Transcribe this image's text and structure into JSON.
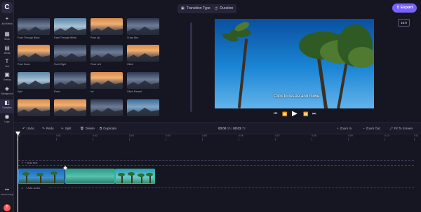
{
  "app": {
    "logo_letter": "C"
  },
  "sidebar": {
    "items": [
      {
        "label": "Add Media",
        "icon": "plus-icon",
        "glyph": "+"
      },
      {
        "label": "Stock",
        "icon": "stock-icon",
        "glyph": "▦"
      },
      {
        "label": "Media",
        "icon": "media-icon",
        "glyph": "▤"
      },
      {
        "label": "Text",
        "icon": "text-icon",
        "glyph": "T"
      },
      {
        "label": "Overlay",
        "icon": "overlay-icon",
        "glyph": "▣"
      },
      {
        "label": "Background",
        "icon": "background-icon",
        "glyph": "◈"
      },
      {
        "label": "Transition",
        "icon": "transition-icon",
        "glyph": "◧"
      },
      {
        "label": "Logo",
        "icon": "logo-icon",
        "glyph": "◉"
      }
    ],
    "feature_flags": "Feature Flags",
    "avatar_letter": "T"
  },
  "topbar": {
    "transition_type": "Transition Type",
    "duration": "Duration",
    "export": "Export"
  },
  "library": {
    "tiles": [
      {
        "caption": "Fade Through Black",
        "style": "dark"
      },
      {
        "caption": "Fade Through White",
        "style": "teal"
      },
      {
        "caption": "Push Up",
        "style": "warm"
      },
      {
        "caption": "Cross Blur",
        "style": "dark"
      },
      {
        "caption": "Push Down",
        "style": "warm"
      },
      {
        "caption": "Push Right",
        "style": "dark"
      },
      {
        "caption": "Push Left",
        "style": "dark"
      },
      {
        "caption": "Glitch",
        "style": "warm"
      },
      {
        "caption": "Split",
        "style": "teal"
      },
      {
        "caption": "Flash",
        "style": "dark"
      },
      {
        "caption": "Ink",
        "style": "warm"
      },
      {
        "caption": "Glitch Reveal",
        "style": "dark"
      },
      {
        "caption": "",
        "style": "warm"
      },
      {
        "caption": "",
        "style": "warm"
      },
      {
        "caption": "",
        "style": "dark"
      },
      {
        "caption": "",
        "style": "blue"
      }
    ]
  },
  "preview": {
    "hint": "Click to resize and move",
    "aspect_ratio": "16:9"
  },
  "timeline": {
    "toolbar": {
      "undo": "Undo",
      "redo": "Redo",
      "split": "Split",
      "delete": "Delete",
      "duplicate": "Duplicate",
      "zoom_in": "Zoom In",
      "zoom_out": "Zoom Out",
      "fit": "Fit To Screen"
    },
    "timecode": {
      "current": "00:00",
      "current_frames": ".00",
      "sep": " | ",
      "total": "00:03",
      "total_frames": ".73"
    },
    "ticks": [
      ":00",
      "0:01",
      "0:02",
      "0:03",
      "0:04",
      "0:05",
      "0:06",
      "0:07",
      "0:08",
      "0:09",
      "0:10",
      "0:11"
    ],
    "add_text": "+ Add text",
    "add_audio": "+ Add audio"
  }
}
